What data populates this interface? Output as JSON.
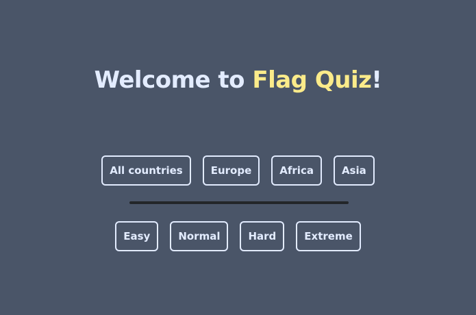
{
  "header": {
    "title_prefix": "Welcome to ",
    "title_accent": "Flag Quiz",
    "title_suffix": "!"
  },
  "regions": [
    {
      "label": "All countries"
    },
    {
      "label": "Europe"
    },
    {
      "label": "Africa"
    },
    {
      "label": "Asia"
    }
  ],
  "difficulties": [
    {
      "label": "Easy"
    },
    {
      "label": "Normal"
    },
    {
      "label": "Hard"
    },
    {
      "label": "Extreme"
    }
  ],
  "colors": {
    "background": "#4a5568",
    "text": "#e3ecff",
    "accent": "#fbeb8a",
    "divider": "#232629"
  }
}
